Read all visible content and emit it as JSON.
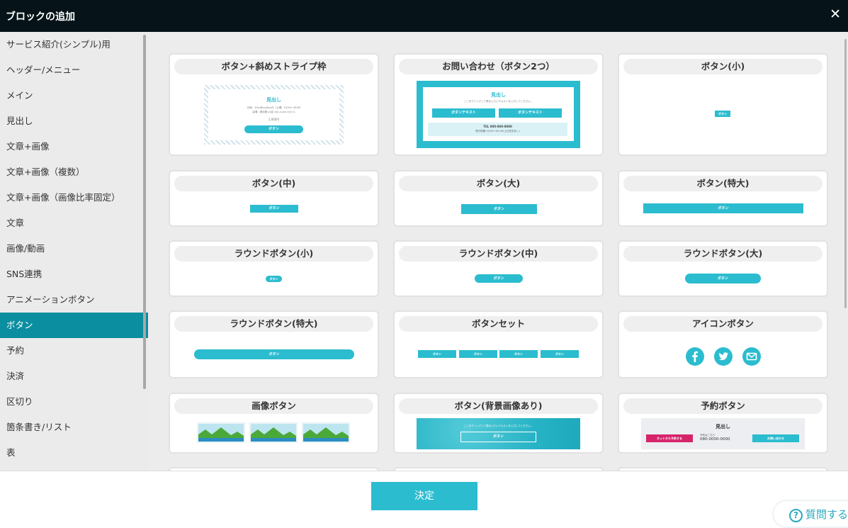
{
  "window": {
    "title": "ブロックの追加",
    "close_label": "✕"
  },
  "sidebar": {
    "active_index": 11,
    "items": [
      {
        "label": "サービス紹介(シンプル)用"
      },
      {
        "label": "ヘッダー/メニュー"
      },
      {
        "label": "メイン"
      },
      {
        "label": "見出し"
      },
      {
        "label": "文章+画像"
      },
      {
        "label": "文章+画像（複数）"
      },
      {
        "label": "文章+画像（画像比率固定）"
      },
      {
        "label": "文章"
      },
      {
        "label": "画像/動画"
      },
      {
        "label": "SNS連携"
      },
      {
        "label": "アニメーションボタン"
      },
      {
        "label": "ボタン"
      },
      {
        "label": "予約"
      },
      {
        "label": "決済"
      },
      {
        "label": "区切り"
      },
      {
        "label": "箇条書き/リスト"
      },
      {
        "label": "表"
      }
    ]
  },
  "blocks": [
    {
      "title": "ボタン+斜めストライプ枠"
    },
    {
      "title": "お問い合わせ（ボタン2つ）"
    },
    {
      "title": "ボタン(小)"
    },
    {
      "title": "ボタン(中)"
    },
    {
      "title": "ボタン(大)"
    },
    {
      "title": "ボタン(特大)"
    },
    {
      "title": "ラウンドボタン(小)"
    },
    {
      "title": "ラウンドボタン(中)"
    },
    {
      "title": "ラウンドボタン(大)"
    },
    {
      "title": "ラウンドボタン(特大)"
    },
    {
      "title": "ボタンセット"
    },
    {
      "title": "アイコンボタン"
    },
    {
      "title": "画像ボタン"
    },
    {
      "title": "ボタン(背景画像あり)"
    },
    {
      "title": "予約ボタン"
    }
  ],
  "preview": {
    "button_label": "ボタン",
    "button_text_label": "ボタンテキスト",
    "heading": "見出し",
    "stripe_info_1": "日時：20xx年xx月xx日（土曜）10:00〜18:00",
    "stripe_info_2": "会場：東京都 xx区 xxx-x-xxx xxビル",
    "stripe_price": "1,000円",
    "contact_sub": "ここをクリックして表示したいテキストを入力してください。",
    "contact_tel": "TEL 000-000-0000",
    "contact_hours": "受付時間 00:00〜00:00(土日祝を除く)",
    "bg_image_text": "ここをクリックして表示したいテキストを入力してください。",
    "reserve_net": "ネットから予約する",
    "reserve_phone_label": "予約はこちら",
    "reserve_phone": "080-0000-0000",
    "reserve_contact": "お問い合わせ"
  },
  "icons": [
    "facebook-icon",
    "twitter-icon",
    "mail-icon"
  ],
  "footer": {
    "confirm_label": "決定",
    "help_label": "質問する"
  },
  "colors": {
    "accent": "#2bbccf",
    "active_sidebar": "#0a8ea0",
    "titlebar": "#061419",
    "pink_button": "#d6246a"
  }
}
